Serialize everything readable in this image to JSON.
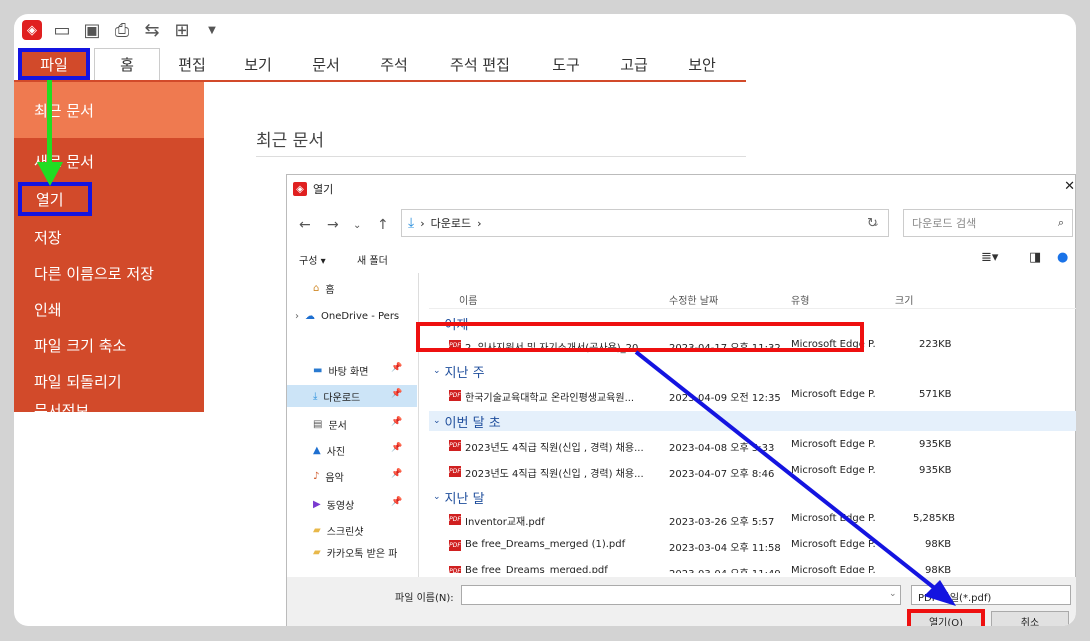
{
  "ribbon": {
    "qat_icons": [
      "acrobat-logo-icon",
      "folder-open-icon",
      "save-icon",
      "print-icon",
      "redo-icon",
      "new-doc-icon",
      "dropdown-icon"
    ],
    "tabs": [
      "파일",
      "홈",
      "편집",
      "보기",
      "문서",
      "주석",
      "주석 편집",
      "도구",
      "고급",
      "보안"
    ]
  },
  "sidebar": {
    "items": [
      "최근 문서",
      "새로 문서",
      "열기",
      "저장",
      "다른 이름으로 저장",
      "인쇄",
      "파일 크기 축소",
      "파일 되돌리기",
      "문서정보"
    ]
  },
  "main": {
    "title": "최근 문서"
  },
  "dialog": {
    "title": "열기",
    "address": "다운로드",
    "search_placeholder": "다운로드 검색",
    "toolbar": {
      "organize": "구성 ▾",
      "new_folder": "새 폴더"
    },
    "nav": [
      {
        "label": "홈",
        "icon": "home-icon"
      },
      {
        "label": "OneDrive - Pers",
        "icon": "cloud-icon"
      },
      {
        "label": "바탕 화면",
        "icon": "desktop-icon"
      },
      {
        "label": "다운로드",
        "icon": "download-icon"
      },
      {
        "label": "문서",
        "icon": "document-icon"
      },
      {
        "label": "사진",
        "icon": "picture-icon"
      },
      {
        "label": "음악",
        "icon": "music-icon"
      },
      {
        "label": "동영상",
        "icon": "video-icon"
      },
      {
        "label": "스크린샷",
        "icon": "folder-icon"
      },
      {
        "label": "카카오톡 받은 파",
        "icon": "folder-icon"
      }
    ],
    "columns": {
      "name": "이름",
      "date": "수정한 날짜",
      "type": "유형",
      "size": "크기"
    },
    "groups": [
      "어제",
      "지난 주",
      "이번 달 초",
      "지난 달"
    ],
    "files": [
      {
        "name": "2. 입사지원서 및 자기소개서(공사용)_20...",
        "date": "2023-04-17 오후 11:32",
        "type": "Microsoft Edge P...",
        "size": "223KB"
      },
      {
        "name": "한국기술교육대학교 온라인평생교육원...",
        "date": "2023-04-09 오전 12:35",
        "type": "Microsoft Edge P...",
        "size": "571KB"
      },
      {
        "name": "2023년도 4직급 직원(신입 , 경력) 채용...",
        "date": "2023-04-08 오후 5:33",
        "type": "Microsoft Edge P...",
        "size": "935KB"
      },
      {
        "name": "2023년도 4직급 직원(신입 , 경력) 채용...",
        "date": "2023-04-07 오후 8:46",
        "type": "Microsoft Edge P...",
        "size": "935KB"
      },
      {
        "name": "Inventor교재.pdf",
        "date": "2023-03-26 오후 5:57",
        "type": "Microsoft Edge P...",
        "size": "5,285KB"
      },
      {
        "name": "Be free_Dreams_merged (1).pdf",
        "date": "2023-03-04 오후 11:58",
        "type": "Microsoft Edge P...",
        "size": "98KB"
      },
      {
        "name": "Be free_Dreams_merged.pdf",
        "date": "2023-03-04 오후 11:49",
        "type": "Microsoft Edge P...",
        "size": "98KB"
      }
    ],
    "filename_label": "파일 이름(N):",
    "filename_value": "",
    "filetype": "PDF 파일(*.pdf)",
    "open_button": "열기(O)",
    "cancel_button": "취소"
  }
}
